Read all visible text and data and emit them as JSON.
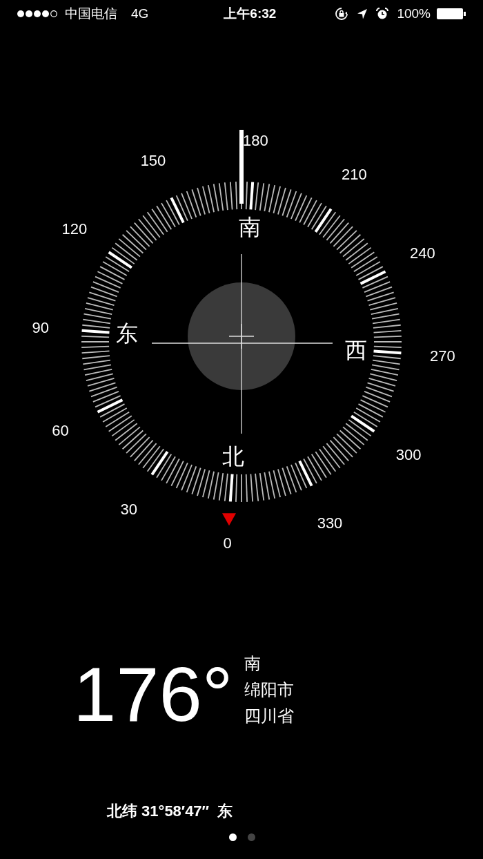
{
  "status_bar": {
    "carrier": "中国电信",
    "network": "4G",
    "time": "上午6:32",
    "battery": "100%"
  },
  "compass": {
    "degree_labels": [
      "0",
      "30",
      "60",
      "90",
      "120",
      "150",
      "180",
      "210",
      "240",
      "270",
      "300",
      "330"
    ],
    "cardinals": [
      "北",
      "东",
      "南",
      "西"
    ]
  },
  "reading": {
    "heading": "176°",
    "direction": "南",
    "city": "绵阳市",
    "province": "四川省",
    "coordinates": "北纬 31°58′47″  东"
  },
  "pages": [
    {
      "selected": true
    },
    {
      "selected": false
    }
  ]
}
